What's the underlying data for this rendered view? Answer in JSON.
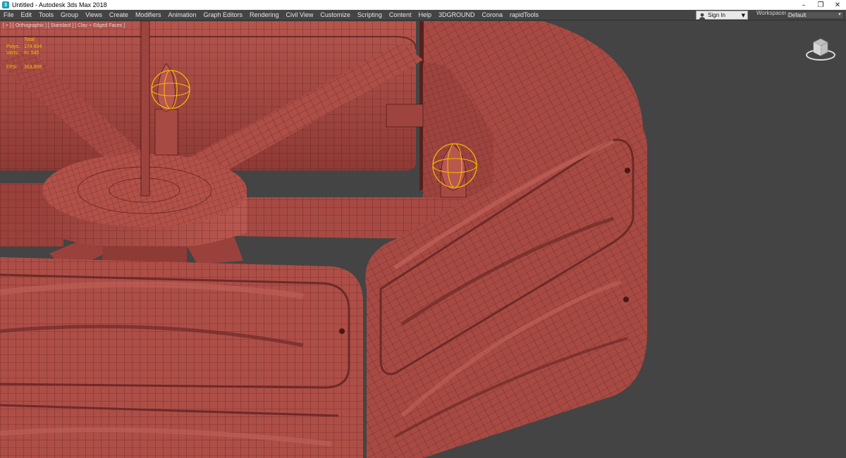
{
  "window": {
    "title": "Untitled - Autodesk 3ds Max 2018",
    "app_icon_glyph": "3",
    "controls": [
      "–",
      "❐",
      "✕"
    ]
  },
  "menubar": {
    "items": [
      "File",
      "Edit",
      "Tools",
      "Group",
      "Views",
      "Create",
      "Modifiers",
      "Animation",
      "Graph Editors",
      "Rendering",
      "Civil View",
      "Customize",
      "Scripting",
      "Content",
      "Help",
      "3DGROUND",
      "Corona",
      "rapidTools"
    ],
    "sign_in_label": "Sign In",
    "workspaces_label": "Workspaces:",
    "workspaces_value": "Default"
  },
  "viewport": {
    "label": "[ + ] [ Orthographic ] [ Standard ] [ Clay + Edged Faces ]",
    "stats": {
      "header": "Total",
      "rows": [
        {
          "key": "Polys:",
          "value": "174 604"
        },
        {
          "key": "Verts:",
          "value": "91 545"
        }
      ],
      "fps_key": "FPS:",
      "fps_value": "363,808"
    },
    "icons": [
      "viewcube-icon",
      "user-icon",
      "app-icon"
    ]
  },
  "colors": {
    "viewport_bg": "#444444",
    "clay": "#a84a44",
    "clay_dark": "#6e2a27",
    "wire": "#4a1714",
    "stats_text": "#f0c400",
    "selection": "#f5b800"
  }
}
